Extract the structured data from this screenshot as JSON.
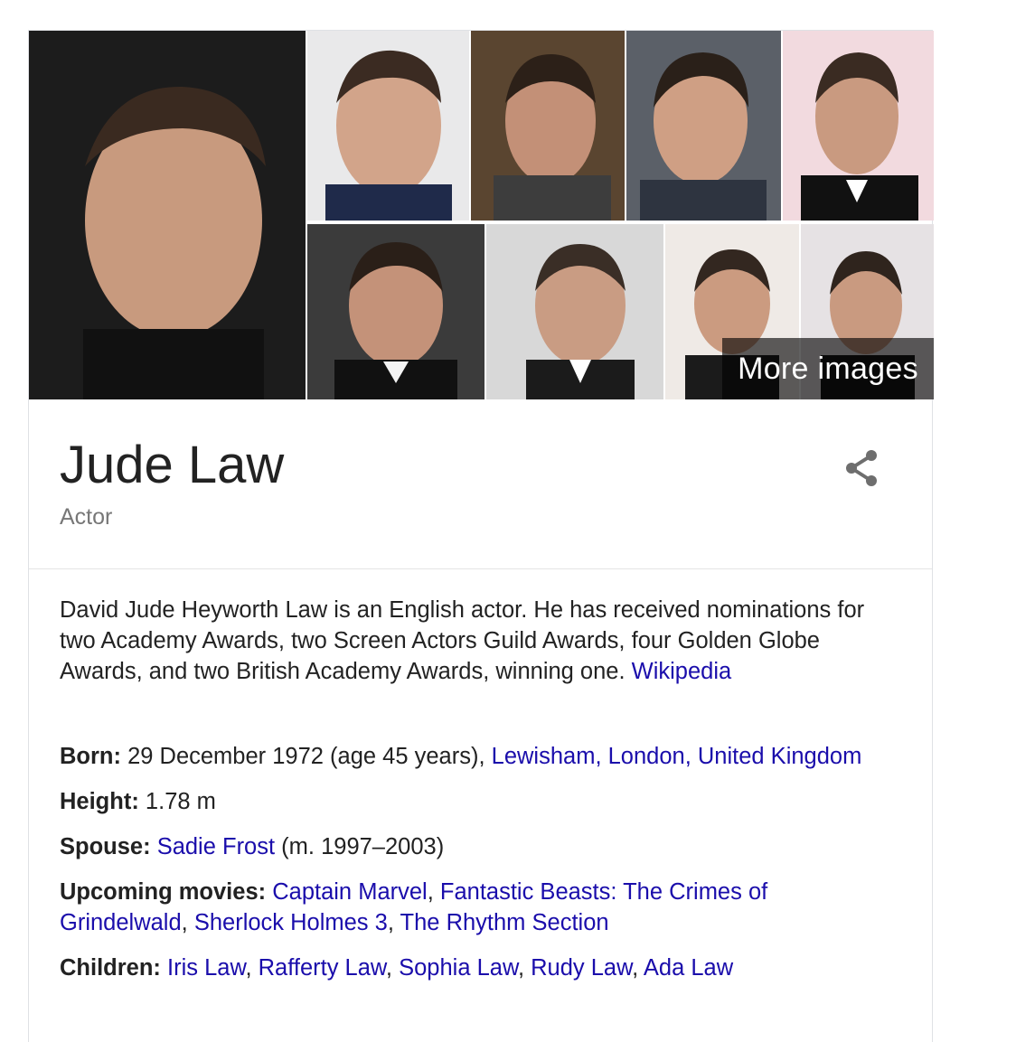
{
  "images": {
    "more_images_label": "More images"
  },
  "entity": {
    "name": "Jude Law",
    "subtitle": "Actor"
  },
  "description": {
    "text": "David Jude Heyworth Law is an English actor. He has received nominations for two Academy Awards, two Screen Actors Guild Awards, four Golden Globe Awards, and two British Academy Awards, winning one.",
    "source_link": "Wikipedia"
  },
  "facts": {
    "born": {
      "label": "Born:",
      "value": "29 December 1972 (age 45 years),",
      "link": "Lewisham, London, United Kingdom"
    },
    "height": {
      "label": "Height:",
      "value": "1.78 m"
    },
    "spouse": {
      "label": "Spouse:",
      "link": "Sadie Frost",
      "value": "(m. 1997–2003)"
    },
    "upcoming_movies": {
      "label": "Upcoming movies:",
      "links": [
        "Captain Marvel",
        "Fantastic Beasts: The Crimes of Grindelwald",
        "Sherlock Holmes 3",
        "The Rhythm Section"
      ]
    },
    "children": {
      "label": "Children:",
      "links": [
        "Iris Law",
        "Rafferty Law",
        "Sophia Law",
        "Rudy Law",
        "Ada Law"
      ]
    }
  },
  "colors": {
    "link": "#1a0dab",
    "text": "#222222",
    "subtitle": "#777777",
    "border": "#dfe1e5"
  },
  "icons": {
    "share": "share-icon"
  }
}
